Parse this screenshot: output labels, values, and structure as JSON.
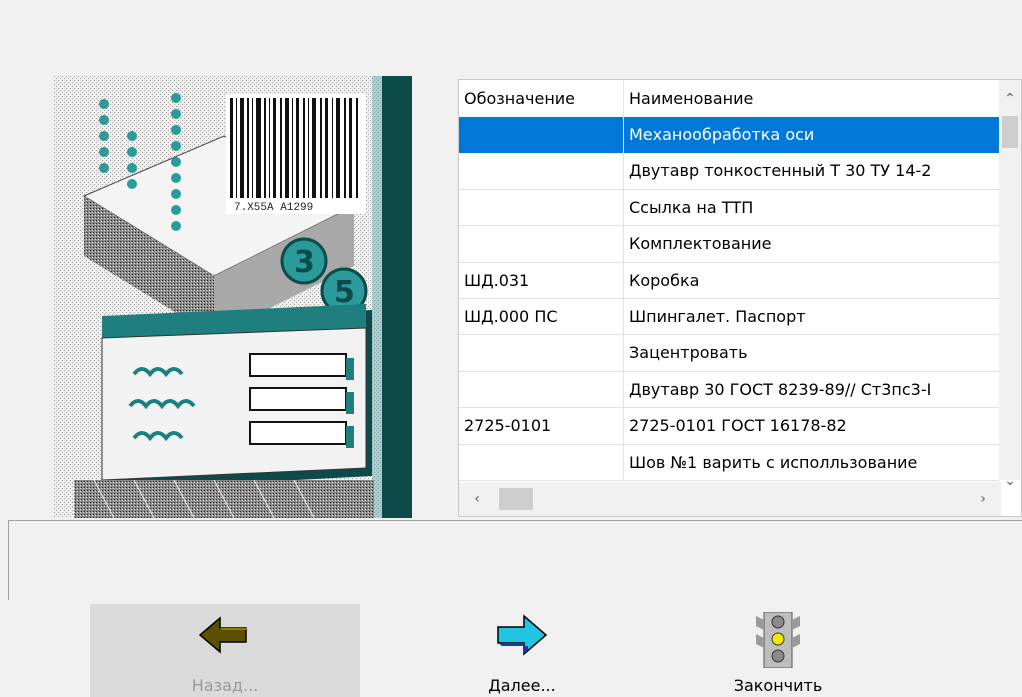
{
  "grid": {
    "headers": [
      "Обозначение",
      "Наименование"
    ],
    "rows": [
      {
        "designation": "",
        "name": "Механообработка оси",
        "selected": true
      },
      {
        "designation": "",
        "name": "Двутавр тонкостенный Т 30 ТУ 14-2"
      },
      {
        "designation": "",
        "name": "Ссылка на ТТП"
      },
      {
        "designation": "",
        "name": "Комплектование"
      },
      {
        "designation": "ШД.031",
        "name": "Коробка"
      },
      {
        "designation": "ШД.000 ПС",
        "name": "Шпингалет. Паспорт"
      },
      {
        "designation": "",
        "name": "Зацентровать"
      },
      {
        "designation": "",
        "name": "Двутавр 30 ГОСТ 8239-89// Ст3пс3-I"
      },
      {
        "designation": "2725-0101",
        "name": "2725-0101 ГОСТ 16178-82"
      },
      {
        "designation": "",
        "name": "Шов №1 варить с исполльзование"
      }
    ]
  },
  "illustration": {
    "barcode_text": "7.X55A A1299",
    "badge_digits": [
      "3",
      "5"
    ]
  },
  "buttons": {
    "back_label": "Назад...",
    "next_label": "Далее...",
    "finish_label": "Закончить",
    "back_enabled": false
  },
  "colors": {
    "selection": "#0078d7",
    "teal": "#2a9a9a",
    "dark_teal": "#0d4a4a",
    "back_arrow": "#5a5000",
    "next_arrow": "#22c4e4"
  },
  "icons": {
    "back": "arrow-left-icon",
    "next": "arrow-right-icon",
    "finish": "traffic-light-icon"
  }
}
